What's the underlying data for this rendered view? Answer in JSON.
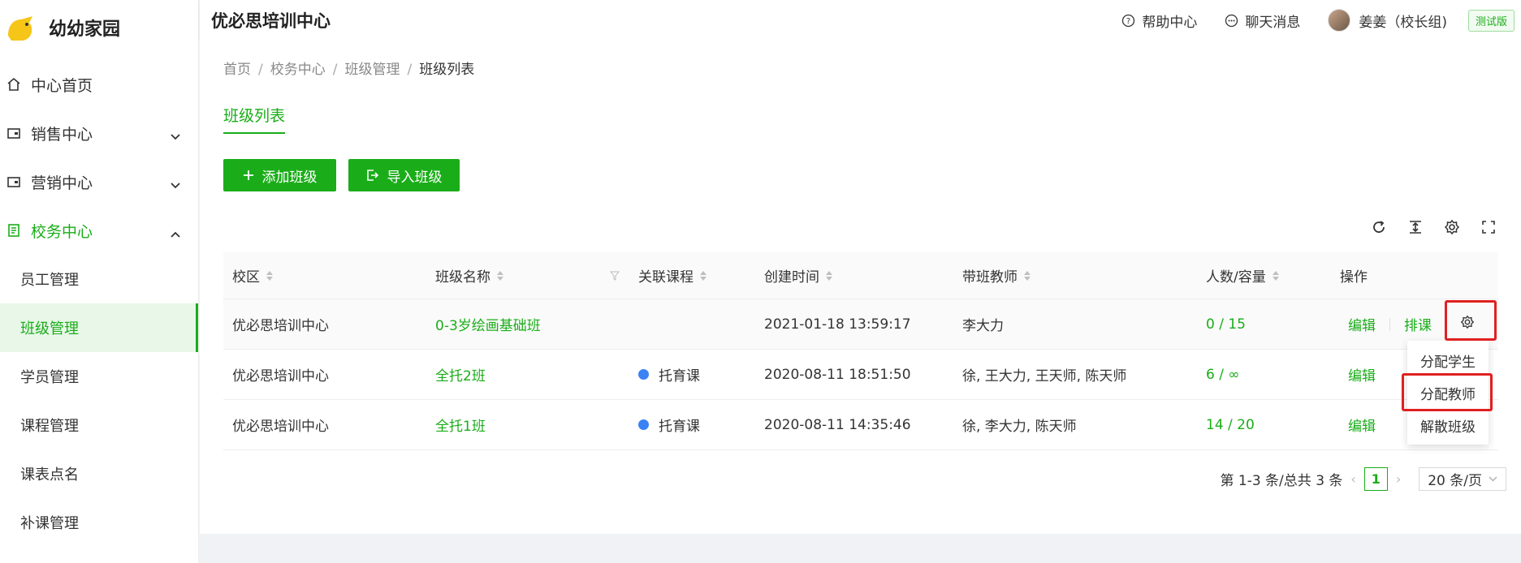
{
  "app": {
    "name": "幼幼家园"
  },
  "sidebar": {
    "items": [
      {
        "label": "中心首页"
      },
      {
        "label": "销售中心"
      },
      {
        "label": "营销中心"
      },
      {
        "label": "校务中心"
      }
    ],
    "sub_items": [
      {
        "label": "员工管理"
      },
      {
        "label": "班级管理"
      },
      {
        "label": "学员管理"
      },
      {
        "label": "课程管理"
      },
      {
        "label": "课表点名"
      },
      {
        "label": "补课管理"
      }
    ]
  },
  "header": {
    "org_title": "优必思培训中心",
    "help": "帮助中心",
    "chat": "聊天消息",
    "user": "姜姜（校长组)",
    "badge": "测试版"
  },
  "breadcrumb": [
    "首页",
    "校务中心",
    "班级管理",
    "班级列表"
  ],
  "tab": "班级列表",
  "buttons": {
    "add": "添加班级",
    "import": "导入班级"
  },
  "table": {
    "columns": [
      "校区",
      "班级名称",
      "关联课程",
      "创建时间",
      "带班教师",
      "人数/容量",
      "操作"
    ],
    "rows": [
      {
        "campus": "优必思培训中心",
        "name": "0-3岁绘画基础班",
        "course": "",
        "created": "2021-01-18 13:59:17",
        "teachers": "李大力",
        "capacity": "0 / 15",
        "edit": "编辑",
        "schedule": "排课"
      },
      {
        "campus": "优必思培训中心",
        "name": "全托2班",
        "course": "托育课",
        "created": "2020-08-11 18:51:50",
        "teachers": "徐, 王大力, 王天师, 陈天师",
        "capacity": "6 / ∞",
        "edit": "编辑"
      },
      {
        "campus": "优必思培训中心",
        "name": "全托1班",
        "course": "托育课",
        "created": "2020-08-11 14:35:46",
        "teachers": "徐, 李大力, 陈天师",
        "capacity": "14 / 20",
        "edit": "编辑"
      }
    ]
  },
  "dropdown": {
    "items": [
      "分配学生",
      "分配教师",
      "解散班级"
    ]
  },
  "pagination": {
    "summary": "第 1-3 条/总共 3 条",
    "current": "1",
    "page_size": "20 条/页"
  },
  "colors": {
    "accent": "#1aad19",
    "highlight": "#e02020",
    "course_dot": "#3b82f6"
  }
}
